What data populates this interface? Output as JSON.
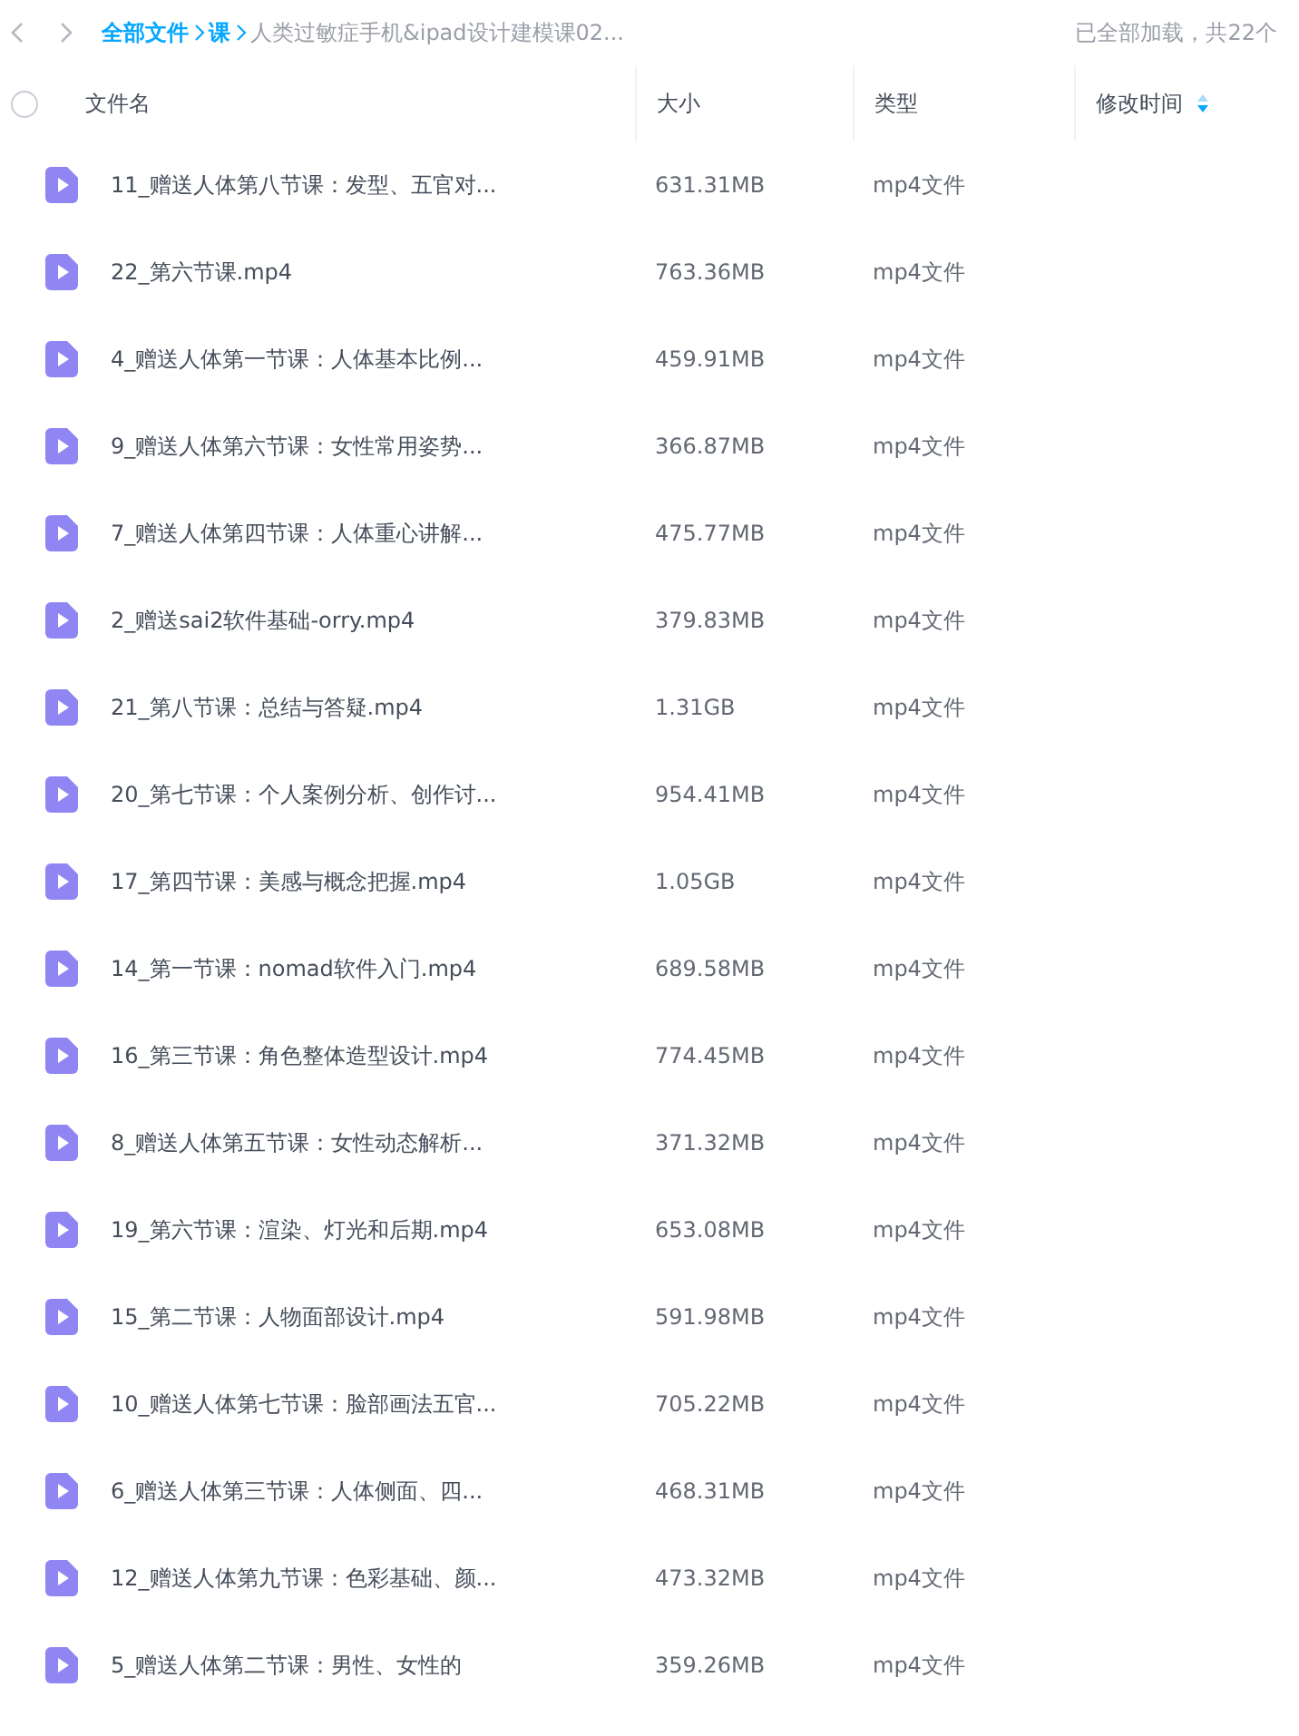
{
  "breadcrumb": {
    "items": [
      {
        "label": "全部文件",
        "kind": "link"
      },
      {
        "label": "课",
        "kind": "link"
      },
      {
        "label": "人类过敏症手机&ipad设计建模课02...",
        "kind": "current"
      }
    ],
    "status": "已全部加载，共22个"
  },
  "table": {
    "select_all": {
      "checked": false
    },
    "columns": [
      {
        "label": "文件名",
        "sorted": false
      },
      {
        "label": "大小",
        "sorted": false
      },
      {
        "label": "类型",
        "sorted": false
      },
      {
        "label": "修改时间",
        "sorted": true
      }
    ],
    "rows": [
      {
        "name": "11_赠送人体第八节课：发型、五官对...",
        "size": "631.31MB",
        "type": "mp4文件"
      },
      {
        "name": "22_第六节课.mp4",
        "size": "763.36MB",
        "type": "mp4文件"
      },
      {
        "name": "4_赠送人体第一节课：人体基本比例...",
        "size": "459.91MB",
        "type": "mp4文件"
      },
      {
        "name": "9_赠送人体第六节课：女性常用姿势...",
        "size": "366.87MB",
        "type": "mp4文件"
      },
      {
        "name": "7_赠送人体第四节课：人体重心讲解...",
        "size": "475.77MB",
        "type": "mp4文件"
      },
      {
        "name": "2_赠送sai2软件基础-orry.mp4",
        "size": "379.83MB",
        "type": "mp4文件"
      },
      {
        "name": "21_第八节课：总结与答疑.mp4",
        "size": "1.31GB",
        "type": "mp4文件"
      },
      {
        "name": "20_第七节课：个人案例分析、创作讨...",
        "size": "954.41MB",
        "type": "mp4文件"
      },
      {
        "name": "17_第四节课：美感与概念把握.mp4",
        "size": "1.05GB",
        "type": "mp4文件"
      },
      {
        "name": "14_第一节课：nomad软件入门.mp4",
        "size": "689.58MB",
        "type": "mp4文件"
      },
      {
        "name": "16_第三节课：角色整体造型设计.mp4",
        "size": "774.45MB",
        "type": "mp4文件"
      },
      {
        "name": "8_赠送人体第五节课：女性动态解析...",
        "size": "371.32MB",
        "type": "mp4文件"
      },
      {
        "name": "19_第六节课：渲染、灯光和后期.mp4",
        "size": "653.08MB",
        "type": "mp4文件"
      },
      {
        "name": "15_第二节课：人物面部设计.mp4",
        "size": "591.98MB",
        "type": "mp4文件"
      },
      {
        "name": "10_赠送人体第七节课：脸部画法五官...",
        "size": "705.22MB",
        "type": "mp4文件"
      },
      {
        "name": "6_赠送人体第三节课：人体侧面、四...",
        "size": "468.31MB",
        "type": "mp4文件"
      },
      {
        "name": "12_赠送人体第九节课：色彩基础、颜...",
        "size": "473.32MB",
        "type": "mp4文件"
      },
      {
        "name": "5_赠送人体第二节课：男性、女性的",
        "size": "359.26MB",
        "type": "mp4文件"
      }
    ]
  }
}
